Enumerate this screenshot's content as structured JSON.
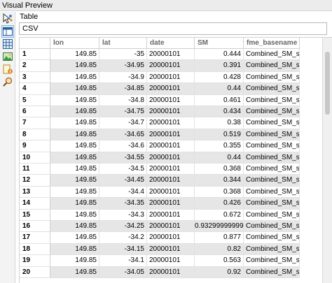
{
  "window": {
    "title": "Visual Preview"
  },
  "view": {
    "label": "Table",
    "format": "CSV"
  },
  "toolbar": {
    "tools": [
      {
        "name": "select-features-tool",
        "icon": "cursor-features-icon"
      },
      {
        "name": "table-view-tool",
        "icon": "table-icon"
      },
      {
        "name": "grid-view-tool",
        "icon": "grid-icon"
      },
      {
        "name": "graphics-view-tool",
        "icon": "image-icon"
      },
      {
        "name": "feature-info-tool",
        "icon": "feature-info-icon"
      },
      {
        "name": "inspect-tool",
        "icon": "magnifier-icon"
      }
    ]
  },
  "table": {
    "columns": [
      "",
      "lon",
      "lat",
      "date",
      "SM",
      "fme_basename"
    ],
    "rows": [
      [
        "1",
        "149.85",
        "-35",
        "20000101",
        "0.444",
        "Combined_SM_sd_..."
      ],
      [
        "2",
        "149.85",
        "-34.95",
        "20000101",
        "0.391",
        "Combined_SM_sd_..."
      ],
      [
        "3",
        "149.85",
        "-34.9",
        "20000101",
        "0.428",
        "Combined_SM_sd_..."
      ],
      [
        "4",
        "149.85",
        "-34.85",
        "20000101",
        "0.44",
        "Combined_SM_sd_..."
      ],
      [
        "5",
        "149.85",
        "-34.8",
        "20000101",
        "0.461",
        "Combined_SM_sd_..."
      ],
      [
        "6",
        "149.85",
        "-34.75",
        "20000101",
        "0.434",
        "Combined_SM_sd_..."
      ],
      [
        "7",
        "149.85",
        "-34.7",
        "20000101",
        "0.38",
        "Combined_SM_sd_..."
      ],
      [
        "8",
        "149.85",
        "-34.65",
        "20000101",
        "0.519",
        "Combined_SM_sd_..."
      ],
      [
        "9",
        "149.85",
        "-34.6",
        "20000101",
        "0.355",
        "Combined_SM_sd_..."
      ],
      [
        "10",
        "149.85",
        "-34.55",
        "20000101",
        "0.44",
        "Combined_SM_sd_..."
      ],
      [
        "11",
        "149.85",
        "-34.5",
        "20000101",
        "0.368",
        "Combined_SM_sd_..."
      ],
      [
        "12",
        "149.85",
        "-34.45",
        "20000101",
        "0.344",
        "Combined_SM_sd_..."
      ],
      [
        "13",
        "149.85",
        "-34.4",
        "20000101",
        "0.368",
        "Combined_SM_sd_..."
      ],
      [
        "14",
        "149.85",
        "-34.35",
        "20000101",
        "0.426",
        "Combined_SM_sd_..."
      ],
      [
        "15",
        "149.85",
        "-34.3",
        "20000101",
        "0.672",
        "Combined_SM_sd_..."
      ],
      [
        "16",
        "149.85",
        "-34.25",
        "20000101",
        "0.93299999999...",
        "Combined_SM_sd_..."
      ],
      [
        "17",
        "149.85",
        "-34.2",
        "20000101",
        "0.877",
        "Combined_SM_sd_..."
      ],
      [
        "18",
        "149.85",
        "-34.15",
        "20000101",
        "0.82",
        "Combined_SM_sd_..."
      ],
      [
        "19",
        "149.85",
        "-34.1",
        "20000101",
        "0.563",
        "Combined_SM_sd_..."
      ],
      [
        "20",
        "149.85",
        "-34.05",
        "20000101",
        "0.92",
        "Combined_SM_sd_..."
      ]
    ]
  }
}
